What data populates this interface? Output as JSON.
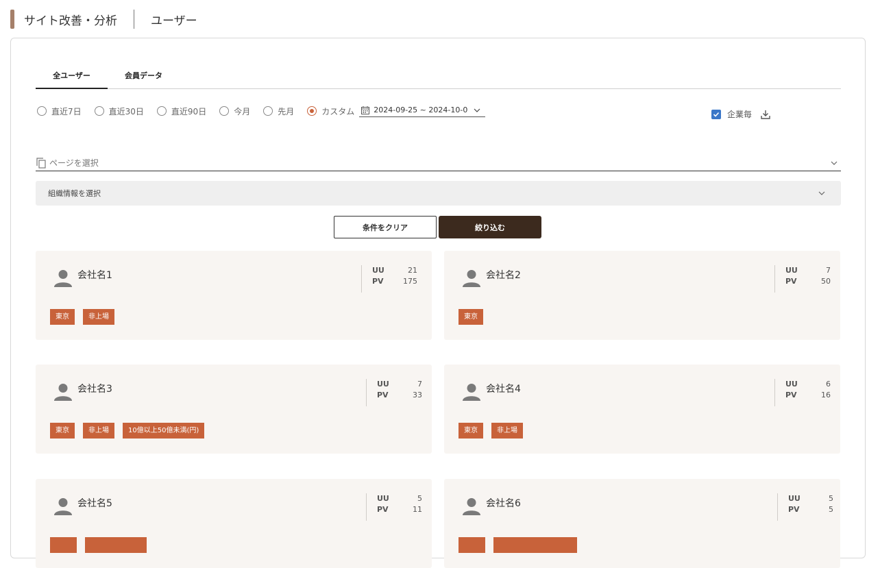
{
  "header": {
    "title": "サイト改善・分析",
    "subtitle": "ユーザー"
  },
  "tabs": [
    {
      "label": "全ユーザー",
      "active": true
    },
    {
      "label": "会員データ",
      "active": false
    }
  ],
  "periods": [
    {
      "label": "直近7日",
      "selected": false
    },
    {
      "label": "直近30日",
      "selected": false
    },
    {
      "label": "直近90日",
      "selected": false
    },
    {
      "label": "今月",
      "selected": false
    },
    {
      "label": "先月",
      "selected": false
    },
    {
      "label": "カスタム",
      "selected": true
    }
  ],
  "date_range": "2024-09-25 ~ 2024-10-0",
  "per_company": {
    "label": "企業毎",
    "checked": true
  },
  "page_select": {
    "placeholder": "ページを選択"
  },
  "org_select": {
    "placeholder": "組織情報を選択"
  },
  "buttons": {
    "clear": "条件をクリア",
    "apply": "絞り込む"
  },
  "metric_labels": {
    "uu": "UU",
    "pv": "PV"
  },
  "companies": [
    {
      "name": "会社名1",
      "uu": "21",
      "pv": "175",
      "tags": [
        "東京",
        "非上場"
      ]
    },
    {
      "name": "会社名2",
      "uu": "7",
      "pv": "50",
      "tags": [
        "東京"
      ]
    },
    {
      "name": "会社名3",
      "uu": "7",
      "pv": "33",
      "tags": [
        "東京",
        "非上場",
        "10億以上50億未満(円)"
      ]
    },
    {
      "name": "会社名4",
      "uu": "6",
      "pv": "16",
      "tags": [
        "東京",
        "非上場"
      ]
    },
    {
      "name": "会社名5",
      "uu": "5",
      "pv": "11",
      "tags": []
    },
    {
      "name": "会社名6",
      "uu": "5",
      "pv": "5",
      "tags": []
    }
  ],
  "colors": {
    "accent": "#c8623a",
    "primary_button": "#3c2a1e",
    "header_accent": "#a5806a",
    "checkbox": "#3a77c8",
    "card_bg": "#f8f5f2"
  }
}
